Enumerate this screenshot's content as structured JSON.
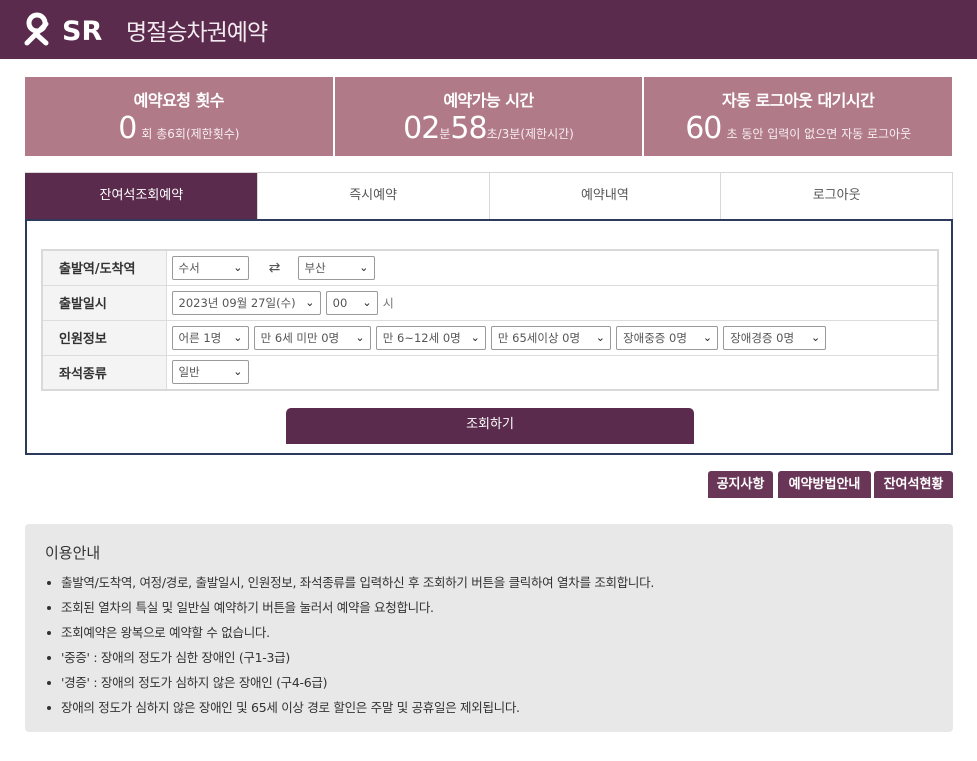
{
  "header": {
    "logo_text": "SR",
    "title": "명절승차권예약"
  },
  "stats": {
    "requests": {
      "title": "예약요청 횟수",
      "count": "0",
      "suffix": "회 총6회(제한횟수)"
    },
    "time": {
      "title": "예약가능 시간",
      "minutes": "02",
      "min_unit": "분",
      "seconds": "58",
      "sec_unit": "초",
      "suffix": "/3분(제한시간)"
    },
    "logout": {
      "title": "자동 로그아웃 대기시간",
      "seconds": "60",
      "suffix": "초 동안 입력이 없으면 자동 로그아웃"
    }
  },
  "tabs": [
    {
      "label": "잔여석조회예약",
      "active": true
    },
    {
      "label": "즉시예약",
      "active": false
    },
    {
      "label": "예약내역",
      "active": false
    },
    {
      "label": "로그아웃",
      "active": false
    }
  ],
  "form": {
    "station": {
      "label": "출발역/도착역",
      "from": "수서",
      "to": "부산"
    },
    "date": {
      "label": "출발일시",
      "date": "2023년 09월 27일(수)",
      "hour": "00",
      "hour_unit": "시"
    },
    "passengers": {
      "label": "인원정보",
      "adult": "어른 1명",
      "child": "만 6세 미만 0명",
      "child2": "만 6~12세 0명",
      "senior": "만 65세이상 0명",
      "severe": "장애중증 0명",
      "mild": "장애경증 0명"
    },
    "seat": {
      "label": "좌석종류",
      "value": "일반"
    },
    "search_button": "조회하기"
  },
  "quick_links": {
    "notice": "공지사항",
    "howto": "예약방법안내",
    "remaining": "잔여석현황"
  },
  "guide": {
    "title": "이용안내",
    "items": [
      "출발역/도착역, 여정/경로, 출발일시, 인원정보, 좌석종류를 입력하신 후 조회하기 버튼을 클릭하여 열차를 조회합니다.",
      "조회된 열차의 특실 및 일반실 예약하기 버튼을 눌러서 예약을 요청합니다.",
      "조회예약은 왕복으로 예약할 수 없습니다.",
      "'중증' : 장애의 정도가 심한 장애인 (구1-3급)",
      "'경증' : 장애의 정도가 심하지 않은 장애인 (구4-6급)",
      "장애의 정도가 심하지 않은 장애인 및 65세 이상 경로 할인은 주말 및 공휴일은 제외됩니다."
    ]
  },
  "colors": {
    "brand": "#5a2b4c",
    "stat_bg": "#b07a88",
    "panel_border": "#2e3a5c",
    "guide_bg": "#e8e8e8"
  }
}
